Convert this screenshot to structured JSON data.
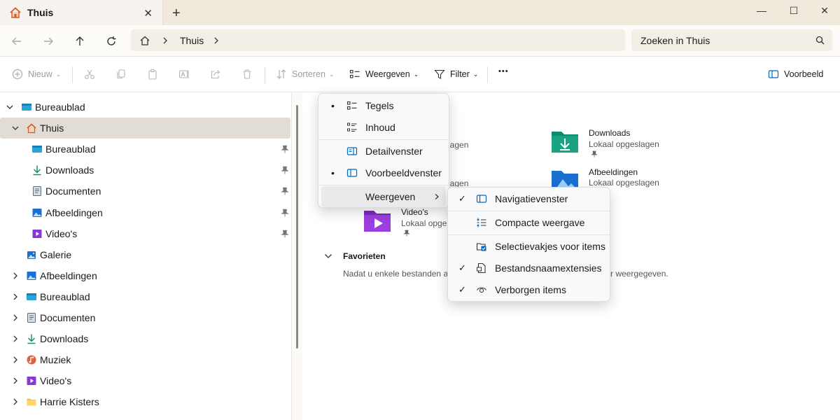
{
  "tabbar": {
    "tab_title": "Thuis",
    "close": "✕",
    "new_tab": "+"
  },
  "window": {
    "minimize": "—",
    "maximize": "☐",
    "close": "✕"
  },
  "address": {
    "breadcrumb": [
      "Thuis"
    ],
    "search_placeholder": "Zoeken in Thuis"
  },
  "commandbar": {
    "new_label": "Nieuw",
    "sort_label": "Sorteren",
    "view_label": "Weergeven",
    "filter_label": "Filter",
    "more": "•••",
    "preview_label": "Voorbeeld"
  },
  "sidebar": {
    "items": [
      {
        "label": "Bureaublad",
        "icon": "desktop-icon",
        "level": 0,
        "expand": "down",
        "pinned": false
      },
      {
        "label": "Thuis",
        "icon": "home-icon",
        "level": 1,
        "expand": "down",
        "pinned": false,
        "selected": true
      },
      {
        "label": "Bureaublad",
        "icon": "desktop-icon",
        "level": 2,
        "expand": "",
        "pinned": true
      },
      {
        "label": "Downloads",
        "icon": "download-icon",
        "level": 2,
        "expand": "",
        "pinned": true
      },
      {
        "label": "Documenten",
        "icon": "document-icon",
        "level": 2,
        "expand": "",
        "pinned": true
      },
      {
        "label": "Afbeeldingen",
        "icon": "pictures-icon",
        "level": 2,
        "expand": "",
        "pinned": true
      },
      {
        "label": "Video's",
        "icon": "video-icon",
        "level": 2,
        "expand": "",
        "pinned": true
      },
      {
        "label": "Galerie",
        "icon": "gallery-icon",
        "level": 1,
        "expand": "",
        "pinned": false
      },
      {
        "label": "Afbeeldingen",
        "icon": "pictures-icon",
        "level": 1,
        "expand": "right",
        "pinned": false
      },
      {
        "label": "Bureaublad",
        "icon": "desktop-icon",
        "level": 1,
        "expand": "right",
        "pinned": false
      },
      {
        "label": "Documenten",
        "icon": "document-icon",
        "level": 1,
        "expand": "right",
        "pinned": false
      },
      {
        "label": "Downloads",
        "icon": "download-icon",
        "level": 1,
        "expand": "right",
        "pinned": false
      },
      {
        "label": "Muziek",
        "icon": "music-icon",
        "level": 1,
        "expand": "right",
        "pinned": false
      },
      {
        "label": "Video's",
        "icon": "video-icon",
        "level": 1,
        "expand": "right",
        "pinned": false
      },
      {
        "label": "Harrie Kisters",
        "icon": "folder-icon",
        "level": 1,
        "expand": "right",
        "pinned": false
      }
    ]
  },
  "content": {
    "quick_access": [
      {
        "name": "Downloads",
        "sub": "Lokaal opgeslagen",
        "icon": "downloads-folder-icon"
      },
      {
        "name": "Afbeeldingen",
        "sub": "Lokaal opgeslagen",
        "icon": "pictures-folder-icon"
      },
      {
        "name": "Video's",
        "sub": "Lokaal opgeslagen",
        "icon": "videos-folder-icon"
      }
    ],
    "partial_sub_1": "lagen",
    "partial_sub_2": "lagen",
    "favorites_title": "Favorieten",
    "favorites_text_left": "Nadat u enkele bestanden al",
    "favorites_text_right": "r weergegeven."
  },
  "view_menu": {
    "items": [
      "Tegels",
      "Inhoud",
      "Detailvenster",
      "Voorbeeldvenster",
      "Weergeven"
    ],
    "bullets": [
      "•",
      "",
      "",
      "•",
      ""
    ]
  },
  "show_submenu": {
    "items": [
      "Navigatievenster",
      "Compacte weergave",
      "Selectievakjes voor items",
      "Bestandsnaamextensies",
      "Verborgen items"
    ],
    "checks": [
      "✓",
      "",
      "",
      "✓",
      "✓"
    ]
  },
  "colors": {
    "accent": "#0067c0",
    "tab_bar": "#f0e9dc",
    "selected_row": "#e2dcd6"
  }
}
